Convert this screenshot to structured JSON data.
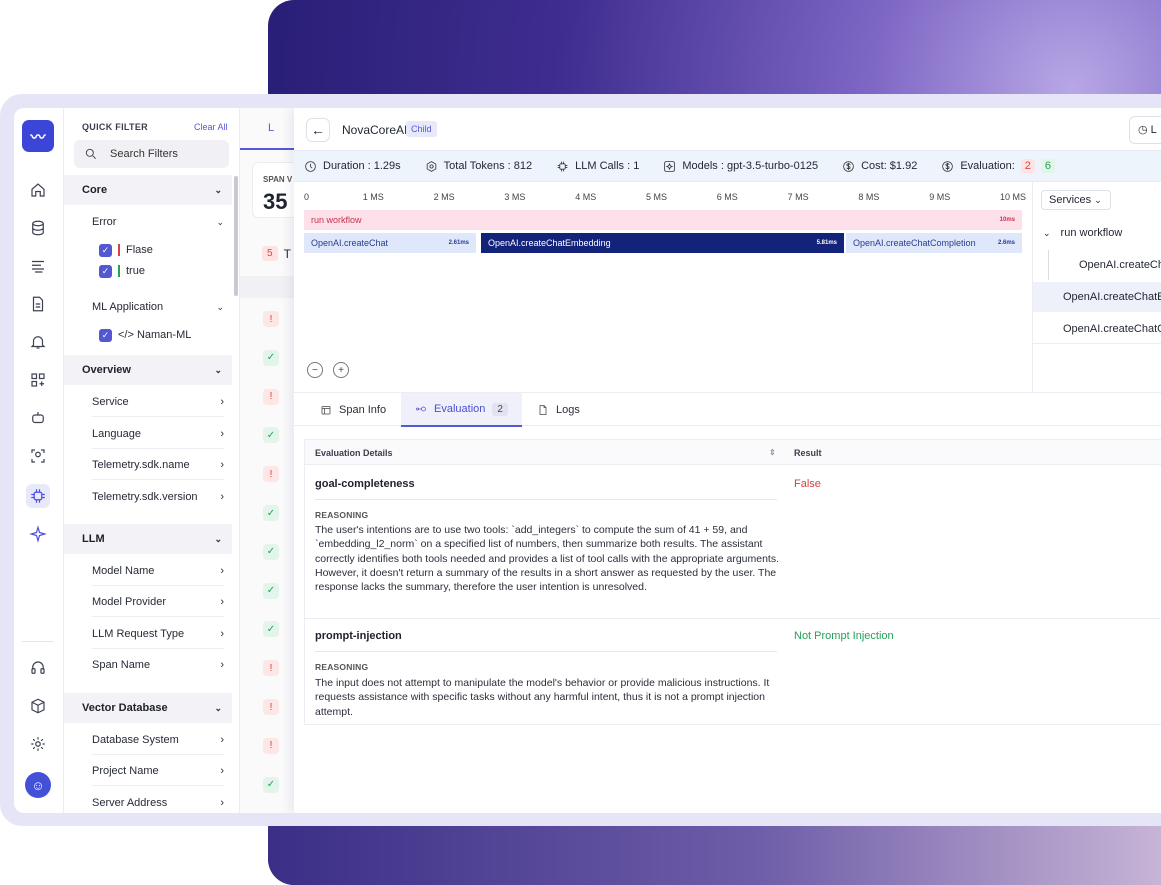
{
  "sidebar": {
    "logo": "〰",
    "avatar": "☺"
  },
  "filter": {
    "title": "QUICK FILTER",
    "clear": "Clear All",
    "search_placeholder": "Search Filters",
    "core": {
      "label": "Core",
      "error_label": "Error",
      "error_options": [
        {
          "label": "Flase",
          "color": "#d84040"
        },
        {
          "label": "true",
          "color": "#23a05a"
        }
      ],
      "ml_label": "ML Application",
      "ml_option": "</> Naman-ML"
    },
    "overview": {
      "label": "Overview",
      "items": [
        "Service",
        "Language",
        "Telemetry.sdk.name",
        "Telemetry.sdk.version"
      ]
    },
    "llm": {
      "label": "LLM",
      "items": [
        "Model Name",
        "Model Provider",
        "LLM Request Type",
        "Span Name"
      ]
    },
    "vector": {
      "label": "Vector Database",
      "items": [
        "Database System",
        "Project Name",
        "Server Address"
      ]
    }
  },
  "spans": {
    "tab_label": "L",
    "card_label": "SPAN V",
    "card_value": "35",
    "count_badge": "5",
    "count_text": "T",
    "statuses": [
      "error",
      "ok",
      "error",
      "ok",
      "error",
      "ok",
      "ok",
      "ok",
      "ok",
      "error",
      "error",
      "error",
      "ok"
    ]
  },
  "main": {
    "title": "NovaCoreAI",
    "badge": "Child",
    "top_right": "L",
    "stats": {
      "duration": "Duration : 1.29s",
      "tokens": "Total Tokens : 812",
      "llm_calls": "LLM Calls : 1",
      "models": "Models : gpt-3.5-turbo-0125",
      "cost": "Cost: $1.92",
      "evaluation": "Evaluation:",
      "eval_fail": "2",
      "eval_pass": "6"
    },
    "timeline": {
      "ticks": [
        "0",
        "1 MS",
        "2 MS",
        "3 MS",
        "4 MS",
        "5 MS",
        "6 MS",
        "7 MS",
        "8 MS",
        "9 MS",
        "10 MS"
      ],
      "workflow": {
        "label": "run workflow",
        "ms": "10ms"
      },
      "spans": [
        {
          "label": "OpenAI.createChat",
          "ms": "2.61ms"
        },
        {
          "label": "OpenAI.createChatEmbedding",
          "ms": "5.81ms"
        },
        {
          "label": "OpenAI.createChatCompletion",
          "ms": "2.6ms"
        }
      ]
    },
    "services": {
      "button": "Services",
      "root": "run workflow",
      "items": [
        "OpenAI.createChatC",
        "OpenAI.createChatE",
        "OpenAI.createChatC"
      ]
    },
    "tabs": {
      "span_info": "Span Info",
      "evaluation": "Evaluation",
      "evaluation_count": "2",
      "logs": "Logs"
    },
    "evaluation_table": {
      "col_details": "Evaluation Details",
      "col_result": "Result",
      "reasoning_label": "REASONING",
      "rows": [
        {
          "name": "goal-completeness",
          "result": "False",
          "reasoning": "The user's intentions are to use two tools: `add_integers` to compute the sum of 41 + 59, and `embedding_l2_norm` on a specified list of numbers, then summarize both results. The assistant correctly identifies both tools needed and provides a list of tool calls with the appropriate arguments. However, it doesn't return a summary of the results in a short answer as requested by the user. The response lacks the summary, therefore the user intention is unresolved."
        },
        {
          "name": "prompt-injection",
          "result": "Not Prompt Injection",
          "reasoning": "The input does not attempt to manipulate the model's behavior or provide malicious instructions. It requests assistance with specific tasks without any harmful intent, thus it is not a prompt injection attempt."
        }
      ]
    }
  },
  "colors": {
    "accent": "#5458d8",
    "workflow_bar": "#fde0ea",
    "span_light": "#dfe8fb",
    "span_dark": "#13237a",
    "false_red": "#d84040",
    "pass_green": "#23a05a"
  }
}
